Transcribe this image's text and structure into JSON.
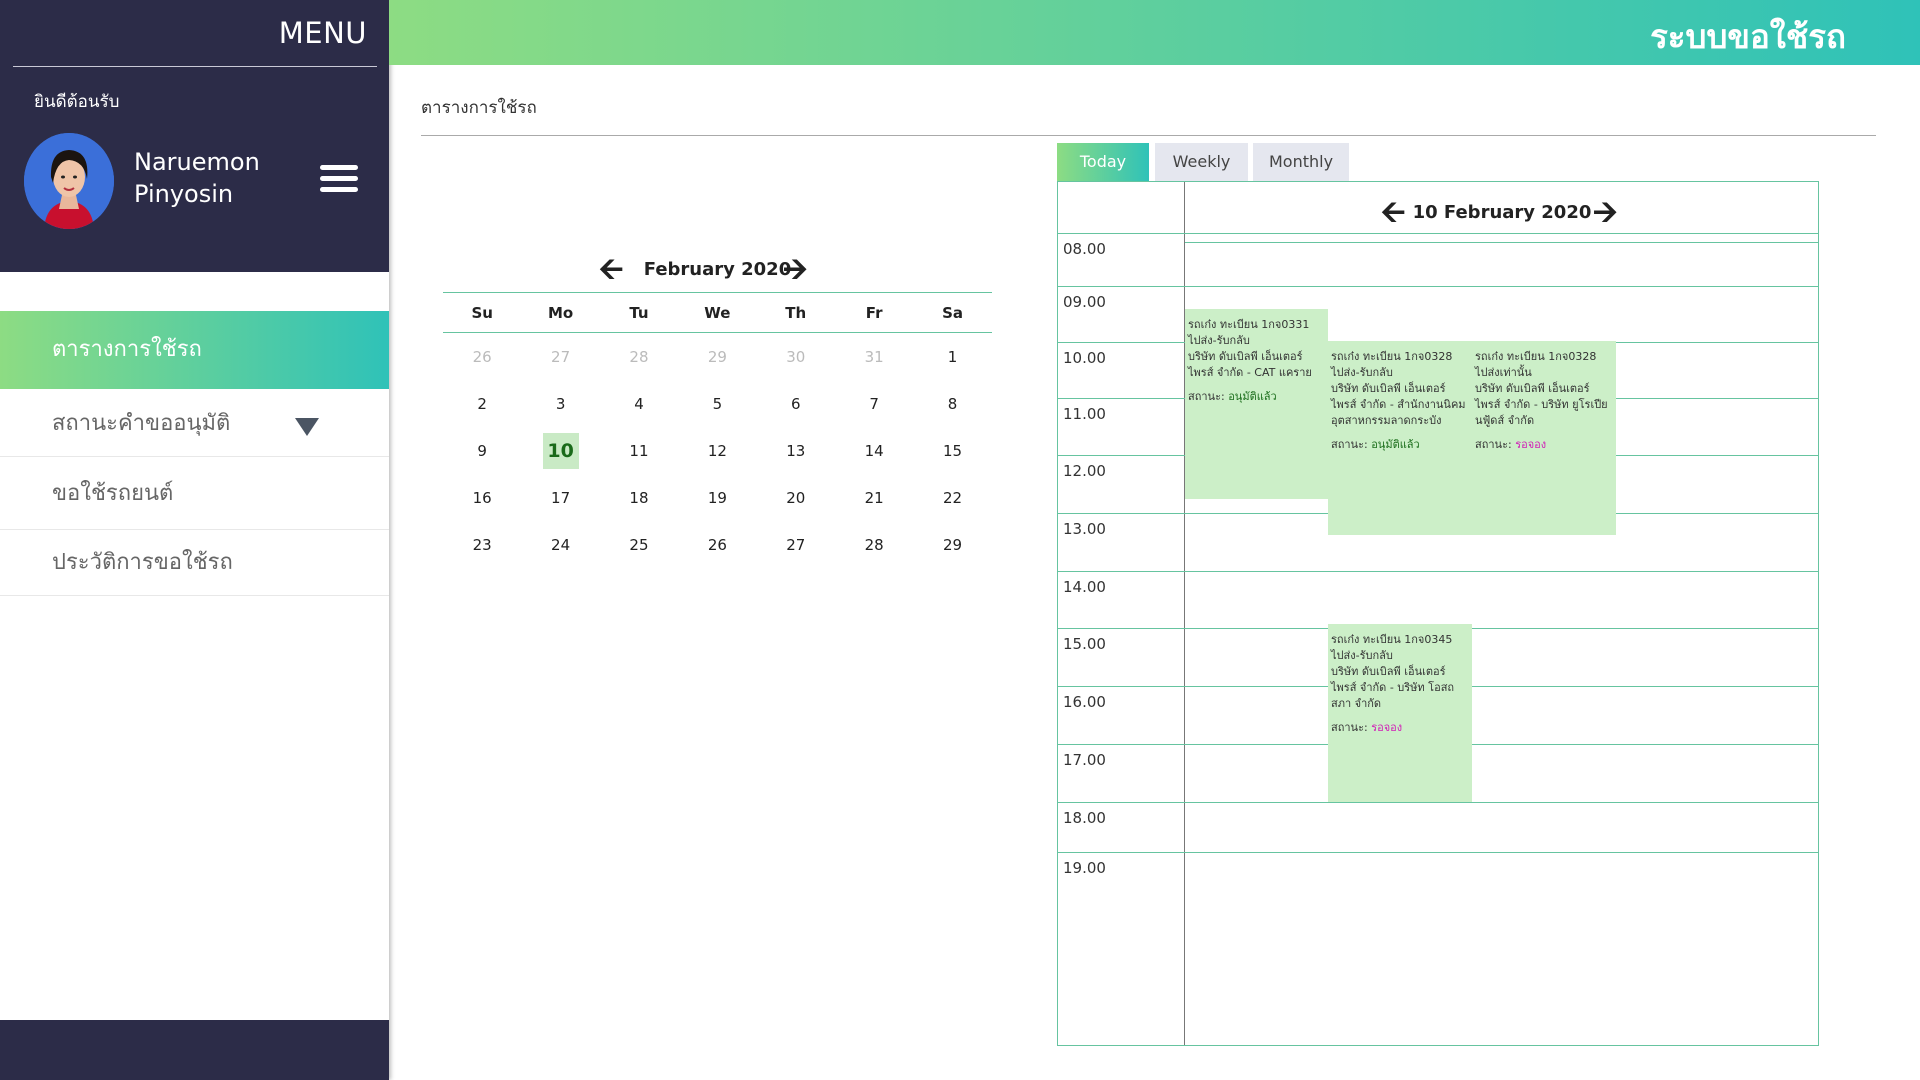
{
  "sidebar": {
    "menu_title": "MENU",
    "welcome": "ยินดีต้อนรับ",
    "user_first": "Naruemon",
    "user_last": "Pinyosin",
    "items": [
      {
        "label": "ตารางการใช้รถ"
      },
      {
        "label": "สถานะคำขออนุมัติ"
      },
      {
        "label": "ขอใช้รถยนต์"
      },
      {
        "label": "ประวัติการขอใช้รถ"
      }
    ]
  },
  "header": {
    "app_title": "ระบบขอใช้รถ"
  },
  "page_title": "ตารางการใช้รถ",
  "mini_calendar": {
    "month_title": "February 2020",
    "weekdays": [
      "Su",
      "Mo",
      "Tu",
      "We",
      "Th",
      "Fr",
      "Sa"
    ],
    "weeks": [
      [
        "26",
        "27",
        "28",
        "29",
        "30",
        "31",
        "1"
      ],
      [
        "2",
        "3",
        "4",
        "5",
        "6",
        "7",
        "8"
      ],
      [
        "9",
        "10",
        "11",
        "12",
        "13",
        "14",
        "15"
      ],
      [
        "16",
        "17",
        "18",
        "19",
        "20",
        "21",
        "22"
      ],
      [
        "23",
        "24",
        "25",
        "26",
        "27",
        "28",
        "29"
      ]
    ],
    "muted_first_row_count": 6,
    "selected_day": "10"
  },
  "tabs": {
    "today": "Today",
    "weekly": "Weekly",
    "monthly": "Monthly"
  },
  "schedule": {
    "date_title": "10 February 2020",
    "hours": [
      "08.00",
      "09.00",
      "10.00",
      "11.00",
      "12.00",
      "13.00",
      "14.00",
      "15.00",
      "16.00",
      "17.00",
      "18.00",
      "19.00"
    ],
    "events": [
      {
        "car": "รถเก๋ง ทะเบียน 1กจ0331",
        "purpose": "ไปส่ง-รับกลับ",
        "company": "บริษัท ดับเบิลพี เอ็นเตอร์ไพรส์ จำกัด - CAT แคราย",
        "status_label": "สถานะ:",
        "status": "อนุมัติแล้ว"
      },
      {
        "car": "รถเก๋ง ทะเบียน 1กจ0328",
        "purpose": "ไปส่ง-รับกลับ",
        "company": "บริษัท ดับเบิลพี เอ็นเตอร์ไพรส์ จำกัด - สำนักงานนิคมอุตสาหกรรมลาดกระบัง",
        "status_label": "สถานะ:",
        "status": "อนุมัติแล้ว"
      },
      {
        "car": "รถเก๋ง ทะเบียน 1กจ0328",
        "purpose": "ไปส่งเท่านั้น",
        "company": "บริษัท ดับเบิลพี เอ็นเตอร์ไพรส์ จำกัด - บริษัท ยูโรเปียนฟู้ดส์ จำกัด",
        "status_label": "สถานะ:",
        "status": "รอจอง"
      },
      {
        "car": "รถเก๋ง ทะเบียน 1กจ0345",
        "purpose": "ไปส่ง-รับกลับ",
        "company": "บริษัท ดับเบิลพี เอ็นเตอร์ไพรส์ จำกัด - บริษัท โอสถสภา จำกัด",
        "status_label": "สถานะ:",
        "status": "รอจอง"
      }
    ]
  },
  "colors": {
    "sidebar_dark": "#2c2c48",
    "gradient_start": "#8ddc83",
    "gradient_end": "#2fc2b8",
    "event_bg": "#ccefc8",
    "status_approved": "#1c6e1c",
    "status_pending": "#d11fb7"
  },
  "icons": [
    "hamburger-icon",
    "caret-down-icon",
    "arrow-left-icon",
    "arrow-right-icon",
    "avatar"
  ]
}
